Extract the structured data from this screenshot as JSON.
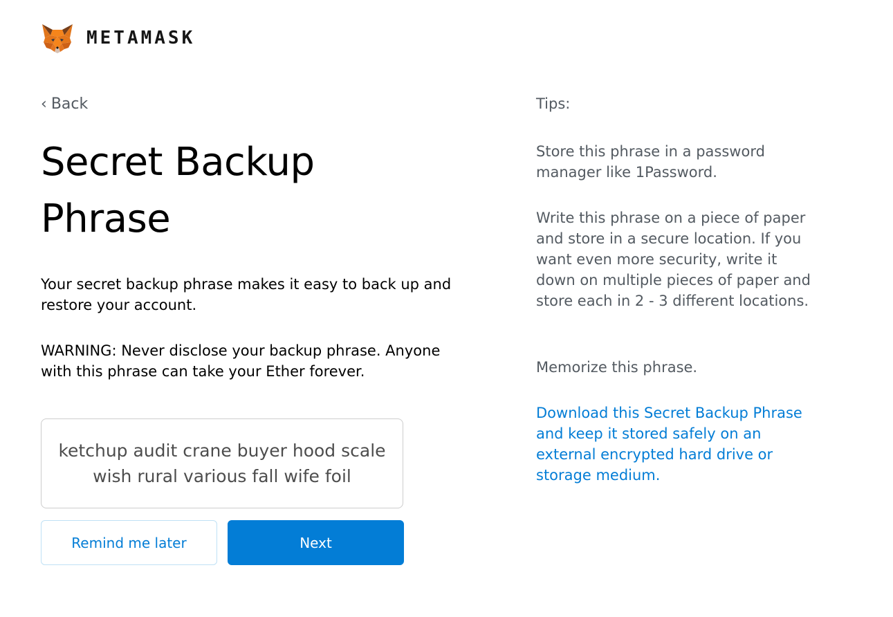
{
  "brand": {
    "name": "METAMASK"
  },
  "nav": {
    "back_chevron": "‹",
    "back_label": "Back"
  },
  "main": {
    "title": "Secret Backup Phrase",
    "description": "Your secret backup phrase makes it easy to back up and restore your account.",
    "warning": "WARNING: Never disclose your backup phrase. Anyone with this phrase can take your Ether forever.",
    "phrase": "ketchup audit crane buyer hood scale wish rural various fall wife foil",
    "remind_label": "Remind me later",
    "next_label": "Next"
  },
  "tips": {
    "title": "Tips:",
    "items": [
      "Store this phrase in a password manager like 1Password.",
      "Write this phrase on a piece of paper and store in a secure location. If you want even more security, write it down on multiple pieces of paper and store each in 2 - 3 different locations.",
      "Memorize this phrase."
    ],
    "download_link": "Download this Secret Backup Phrase and keep it stored safely on an external encrypted hard drive or storage medium."
  },
  "colors": {
    "primary": "#037dd6",
    "text_dark": "#000000",
    "text_muted": "#535a61",
    "phrase_border": "#cdcdcd",
    "fox_orange": "#f6851b"
  },
  "icons": {
    "logo": "metamask-fox-icon",
    "back": "chevron-left-icon"
  }
}
